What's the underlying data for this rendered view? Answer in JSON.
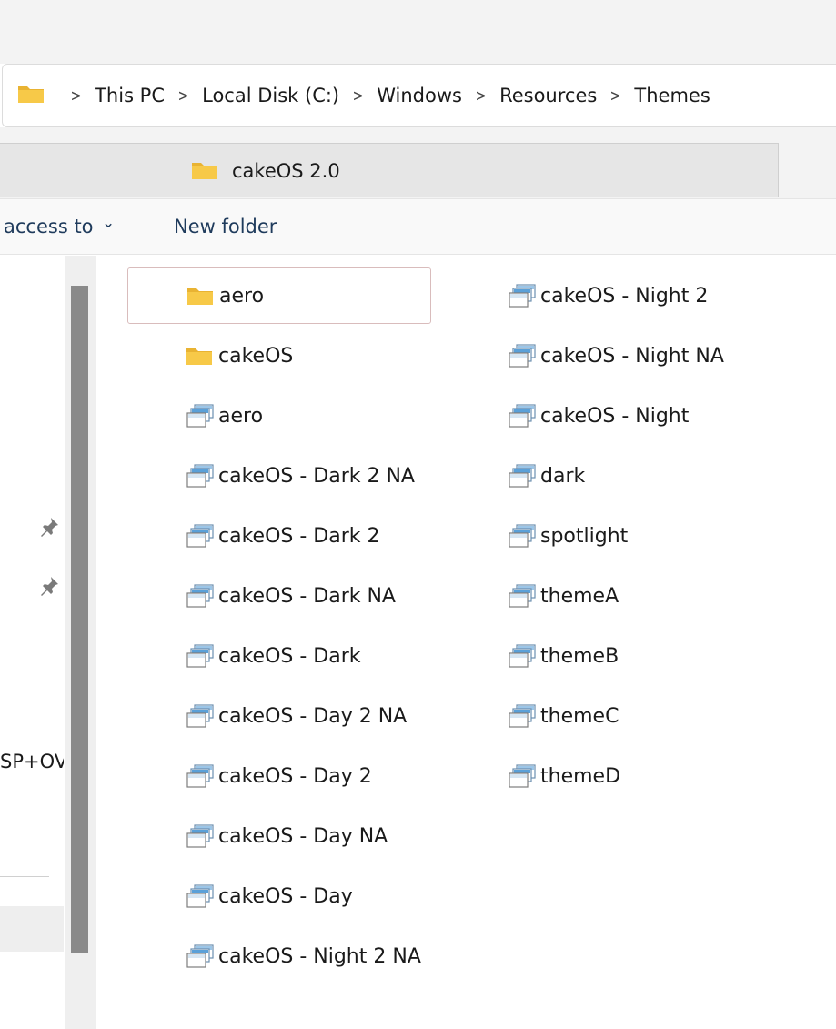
{
  "address": {
    "crumbs": [
      "This PC",
      "Local Disk (C:)",
      "Windows",
      "Resources",
      "Themes"
    ]
  },
  "tab": {
    "label": "cakeOS 2.0"
  },
  "toolbar": {
    "share_label": "access to",
    "new_folder_label": "New folder"
  },
  "nav": {
    "partial_item": "SP+OVA"
  },
  "files": {
    "col1": [
      {
        "name": "aero",
        "type": "folder",
        "selected": true
      },
      {
        "name": "cakeOS",
        "type": "folder"
      },
      {
        "name": "aero",
        "type": "theme"
      },
      {
        "name": "cakeOS - Dark 2 NA",
        "type": "theme"
      },
      {
        "name": "cakeOS - Dark 2",
        "type": "theme"
      },
      {
        "name": "cakeOS - Dark NA",
        "type": "theme"
      },
      {
        "name": "cakeOS - Dark",
        "type": "theme"
      },
      {
        "name": "cakeOS - Day 2 NA",
        "type": "theme"
      },
      {
        "name": "cakeOS - Day 2",
        "type": "theme"
      },
      {
        "name": "cakeOS - Day NA",
        "type": "theme"
      },
      {
        "name": "cakeOS - Day",
        "type": "theme"
      },
      {
        "name": "cakeOS - Night 2 NA",
        "type": "theme"
      }
    ],
    "col2": [
      {
        "name": "cakeOS - Night 2",
        "type": "theme"
      },
      {
        "name": "cakeOS - Night NA",
        "type": "theme"
      },
      {
        "name": "cakeOS - Night",
        "type": "theme"
      },
      {
        "name": "dark",
        "type": "theme"
      },
      {
        "name": "spotlight",
        "type": "theme"
      },
      {
        "name": "themeA",
        "type": "theme"
      },
      {
        "name": "themeB",
        "type": "theme"
      },
      {
        "name": "themeC",
        "type": "theme"
      },
      {
        "name": "themeD",
        "type": "theme"
      }
    ]
  },
  "icons": {
    "folder": "folder-icon",
    "theme": "theme-file-icon",
    "pin": "pin-icon",
    "chevron": "chevron-down-icon",
    "separator": "chevron-right-icon"
  },
  "colors": {
    "folder": "#f7c948",
    "selection_border": "#d9bcbc",
    "toolbar_text": "#1f3b5c"
  }
}
